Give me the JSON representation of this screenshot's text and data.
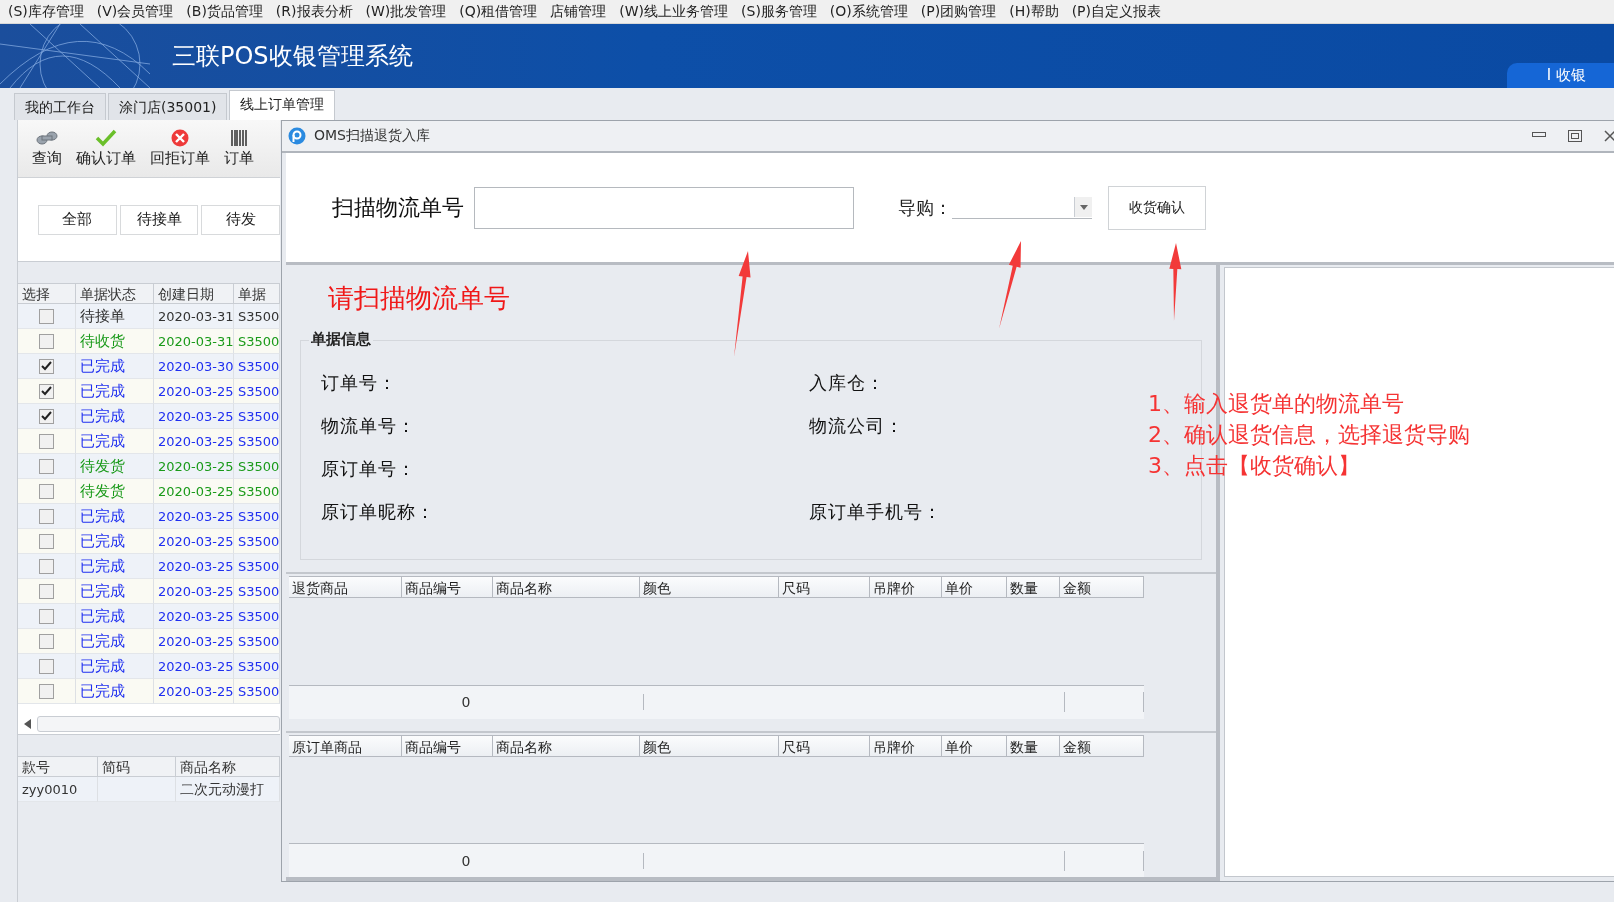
{
  "menu": [
    "(S)库存管理",
    "(V)会员管理",
    "(B)货品管理",
    "(R)报表分析",
    "(W)批发管理",
    "(Q)租借管理",
    "店铺管理",
    "(W)线上业务管理",
    "(S)服务管理",
    "(O)系统管理",
    "(P)团购管理",
    "(H)帮助",
    "(P)自定义报表"
  ],
  "app_title": "三联POS收银管理系统",
  "header_tab": "I 收银",
  "tabs": [
    {
      "label": "我的工作台",
      "selected": false
    },
    {
      "label": "涂门店(35001)",
      "selected": false
    },
    {
      "label": "线上订单管理",
      "selected": true
    }
  ],
  "toolbar": [
    {
      "kind": "search",
      "label": "查询"
    },
    {
      "kind": "confirm",
      "label": "确认订单"
    },
    {
      "kind": "reject",
      "label": "回拒订单"
    },
    {
      "kind": "barcode",
      "label": "订单"
    }
  ],
  "filters": [
    "全部",
    "待接单",
    "待发"
  ],
  "orders": {
    "columns": [
      "选择",
      "单据状态",
      "创建日期",
      "单据"
    ],
    "rows": [
      {
        "checked": false,
        "status": "待接单",
        "date": "2020-03-31",
        "number": "S3500",
        "color": "#333333"
      },
      {
        "checked": false,
        "status": "待收货",
        "date": "2020-03-31",
        "number": "S3500",
        "color": "#1a9a1a"
      },
      {
        "checked": true,
        "status": "已完成",
        "date": "2020-03-30",
        "number": "S3500",
        "color": "#1f2ff0"
      },
      {
        "checked": true,
        "status": "已完成",
        "date": "2020-03-25",
        "number": "S3500",
        "color": "#1f2ff0"
      },
      {
        "checked": true,
        "status": "已完成",
        "date": "2020-03-25",
        "number": "S3500",
        "color": "#1f2ff0"
      },
      {
        "checked": false,
        "status": "已完成",
        "date": "2020-03-25",
        "number": "S3500",
        "color": "#1f2ff0"
      },
      {
        "checked": false,
        "status": "待发货",
        "date": "2020-03-25",
        "number": "S3500",
        "color": "#1a9a1a"
      },
      {
        "checked": false,
        "status": "待发货",
        "date": "2020-03-25",
        "number": "S3500",
        "color": "#1a9a1a"
      },
      {
        "checked": false,
        "status": "已完成",
        "date": "2020-03-25",
        "number": "S3500",
        "color": "#1f2ff0"
      },
      {
        "checked": false,
        "status": "已完成",
        "date": "2020-03-25",
        "number": "S3500",
        "color": "#1f2ff0"
      },
      {
        "checked": false,
        "status": "已完成",
        "date": "2020-03-25",
        "number": "S3500",
        "color": "#1f2ff0"
      },
      {
        "checked": false,
        "status": "已完成",
        "date": "2020-03-25",
        "number": "S3500",
        "color": "#1f2ff0"
      },
      {
        "checked": false,
        "status": "已完成",
        "date": "2020-03-25",
        "number": "S3500",
        "color": "#1f2ff0"
      },
      {
        "checked": false,
        "status": "已完成",
        "date": "2020-03-25",
        "number": "S3500",
        "color": "#1f2ff0"
      },
      {
        "checked": false,
        "status": "已完成",
        "date": "2020-03-25",
        "number": "S3500",
        "color": "#1f2ff0"
      },
      {
        "checked": false,
        "status": "已完成",
        "date": "2020-03-25",
        "number": "S3500",
        "color": "#1f2ff0"
      }
    ]
  },
  "items": {
    "columns": [
      "款号",
      "简码",
      "商品名称"
    ],
    "rows": [
      [
        "zyy0010",
        "",
        "二次元动漫打"
      ]
    ]
  },
  "dialog": {
    "title": "OMS扫描退货入库",
    "scan_label": "扫描物流单号",
    "guide_label": "导购：",
    "confirm_button": "收货确认",
    "prompt": "请扫描物流单号",
    "group_title": "单据信息",
    "field_rows": [
      [
        "订单号：",
        "入库仓："
      ],
      [
        "物流单号：",
        "物流公司："
      ],
      [
        "原订单号："
      ],
      [
        "原订单昵称：",
        "原订单手机号："
      ]
    ],
    "tables": [
      {
        "columns": [
          "退货商品",
          "商品编号",
          "商品名称",
          "颜色",
          "尺码",
          "吊牌价",
          "单价",
          "数量",
          "金额"
        ],
        "total": "0"
      },
      {
        "columns": [
          "原订单商品",
          "商品编号",
          "商品名称",
          "颜色",
          "尺码",
          "吊牌价",
          "单价",
          "数量",
          "金额"
        ],
        "total": "0"
      }
    ]
  },
  "annotations": [
    "1、输入退货单的物流单号",
    "2、确认退货信息，选择退货导购",
    "3、点击【收货确认】"
  ]
}
